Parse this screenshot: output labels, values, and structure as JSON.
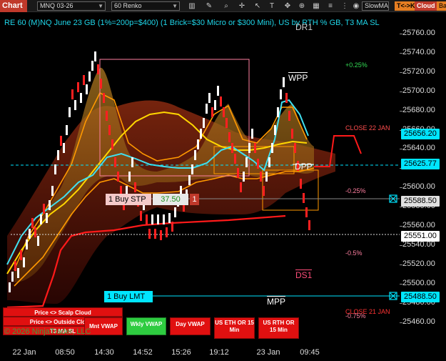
{
  "toolbar": {
    "title": "Chart",
    "instrument": "MNQ 03-26",
    "interval": "60 Renko",
    "indicator_select": "SlowMA",
    "tc_button": "T<->K",
    "cloud_button": "Cloud",
    "bar_button": "Bar",
    "icons": [
      "bar-chart-icon",
      "pencil-icon",
      "magnify-icon",
      "crosshair-icon",
      "cursor-icon",
      "text-icon",
      "move-icon",
      "zoom-icon",
      "grid-icon",
      "layers-icon",
      "dots-icon",
      "eye-icon",
      "bolt-icon",
      "window-icon"
    ]
  },
  "chart": {
    "title": "RE 60 (M)NQ June 23 GB (1%=200p=$400) (1 Brick=$30 Micro or $300 Mini), US by RTH % GB, T3 MA SL",
    "price_labels": [
      "25760.00",
      "25740.00",
      "25720.00",
      "25700.00",
      "25680.00",
      "25660.00",
      "25640.00",
      "25620.00",
      "25600.00",
      "25580.00",
      "25560.00",
      "25540.00",
      "25520.00",
      "25500.00",
      "25480.00",
      "25460.00"
    ],
    "time_labels": [
      "22 Jan",
      "08:50",
      "14:30",
      "14:52",
      "15:26",
      "19:12",
      "23 Jan",
      "09:45"
    ],
    "price_badges": [
      {
        "value": "25656.20",
        "bg": "#00e5ff",
        "fg": "#000"
      },
      {
        "value": "25625.77",
        "bg": "#00e5ff",
        "fg": "#000"
      },
      {
        "value": "25588.50",
        "bg": "#e0e0e0",
        "fg": "#000"
      },
      {
        "value": "25551.00",
        "bg": "#ffffff",
        "fg": "#000"
      },
      {
        "value": "25488.50",
        "bg": "#00e5ff",
        "fg": "#000"
      }
    ],
    "levels": {
      "dr1": "DR1",
      "wpp": "WPP",
      "dpp": "DPP",
      "ds1": "DS1",
      "mpp": "MPP",
      "close_22": "CLOSE 22 JAN",
      "close_21": "CLOSE 21 JAN"
    },
    "percents": {
      "p025": "+0.25%",
      "m025": "-0.25%",
      "m05": "-0.5%",
      "m075": "-0.75%"
    },
    "orders": {
      "stop_label": "1 Buy STP",
      "stop_price": "37.50",
      "stop_qty": "1",
      "limit_label": "1 Buy LMT"
    },
    "copyright": "© 2026 NinjaTrader, LLC"
  },
  "buttons": {
    "scalp_cloud": "Price <> Scalp Cloud",
    "outside_clouds": "Price <> Outside Clouds",
    "t3_ma_sl": "T3 MA SL",
    "mnt_vwap": "Mnt VWAP",
    "wkly_vwap": "Wkly VWAP",
    "day_vwap": "Day VWAP",
    "us_eth": "US ETH OR 15 Min",
    "us_rth": "US RTH OR 15 Min"
  },
  "colors": {
    "up_brick": "#ffffff",
    "down_brick": "#ff2020",
    "cyan_ma": "#00e5ff",
    "yellow_ma": "#ffd700",
    "orange_band": "#ff9900",
    "cloud": "#7a1a0a"
  }
}
